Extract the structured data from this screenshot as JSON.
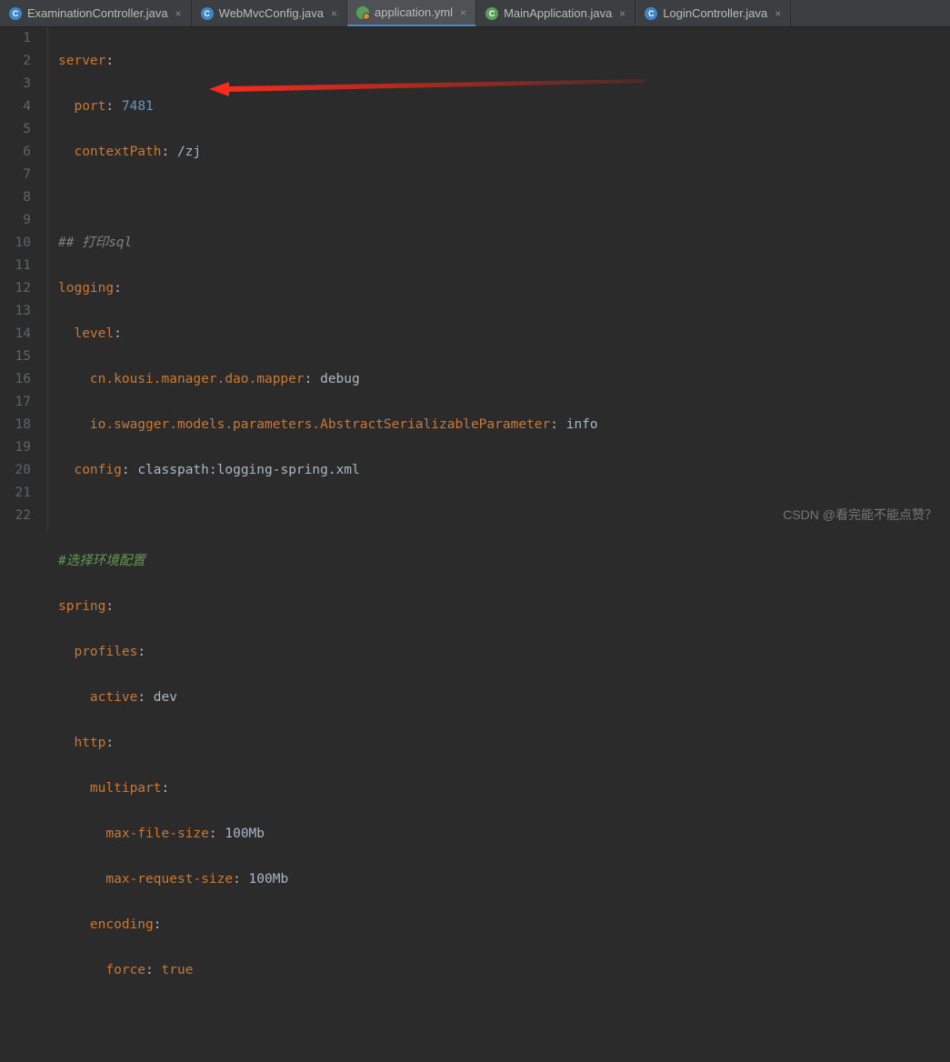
{
  "tabs": [
    {
      "label": "ExaminationController.java",
      "iconClass": "icon-java",
      "iconGlyph": "C",
      "active": false
    },
    {
      "label": "WebMvcConfig.java",
      "iconClass": "icon-java",
      "iconGlyph": "C",
      "active": false
    },
    {
      "label": "application.yml",
      "iconClass": "icon-yml",
      "iconGlyph": "",
      "active": true
    },
    {
      "label": "MainApplication.java",
      "iconClass": "icon-main",
      "iconGlyph": "C",
      "active": false
    },
    {
      "label": "LoginController.java",
      "iconClass": "icon-java",
      "iconGlyph": "C",
      "active": false
    }
  ],
  "closeGlyph": "×",
  "code": {
    "l1": {
      "k": "server",
      "c": ":"
    },
    "l2": {
      "k": "port",
      "c": ": ",
      "v": "7481"
    },
    "l3": {
      "k": "contextPath",
      "c": ": ",
      "v": "/zj"
    },
    "l4": {},
    "l5": {
      "cmt": "## 打印sql"
    },
    "l6": {
      "k": "logging",
      "c": ":"
    },
    "l7": {
      "k": "level",
      "c": ":"
    },
    "l8": {
      "k": "cn.kousi.manager.dao.mapper",
      "c": ": ",
      "v": "debug"
    },
    "l9": {
      "k": "io.swagger.models.parameters.AbstractSerializableParameter",
      "c": ": ",
      "v": "info"
    },
    "l10": {
      "k": "config",
      "c": ": ",
      "v": "classpath:logging-spring.xml"
    },
    "l11": {},
    "l12": {
      "cmtg": "#选择环境配置"
    },
    "l13": {
      "k": "spring",
      "c": ":"
    },
    "l14": {
      "k": "profiles",
      "c": ":"
    },
    "l15": {
      "k": "active",
      "c": ": ",
      "v": "dev"
    },
    "l16": {
      "k": "http",
      "c": ":"
    },
    "l17": {
      "k": "multipart",
      "c": ":"
    },
    "l18": {
      "k": "max-file-size",
      "c": ": ",
      "v": "100Mb"
    },
    "l19": {
      "k": "max-request-size",
      "c": ": ",
      "v": "100Mb"
    },
    "l20": {
      "k": "encoding",
      "c": ":"
    },
    "l21": {
      "k": "force",
      "c": ": ",
      "b": "true"
    },
    "l22": {}
  },
  "watermark": "CSDN @看完能不能点赞？"
}
